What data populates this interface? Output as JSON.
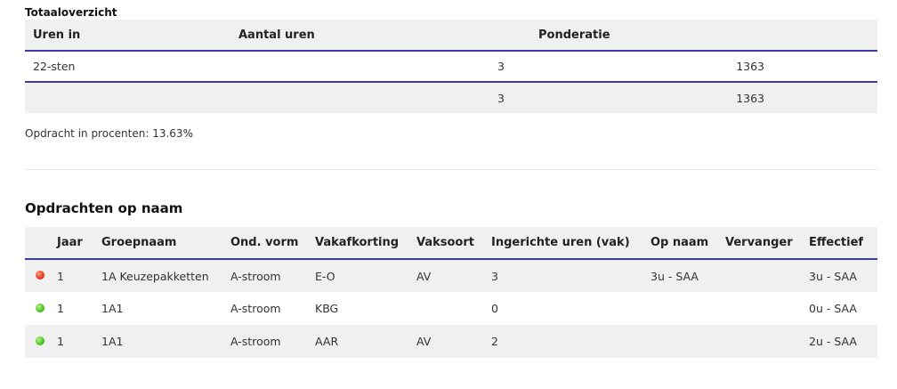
{
  "totaal": {
    "title": "Totaaloverzicht",
    "headers": {
      "uren_in": "Uren in",
      "aantal_uren": "Aantal uren",
      "ponderatie": "Ponderatie"
    },
    "rows": [
      {
        "uren_in": "22-sten",
        "aantal": "3",
        "ponderatie": "1363"
      },
      {
        "uren_in": "",
        "aantal": "3",
        "ponderatie": "1363"
      }
    ],
    "percent_text": "Opdracht in procenten: 13.63%"
  },
  "opdrachten": {
    "title": "Opdrachten op naam",
    "headers": {
      "jaar": "Jaar",
      "groepnaam": "Groepnaam",
      "ond_vorm": "Ond. vorm",
      "vakafkorting": "Vakafkorting",
      "vaksoort": "Vaksoort",
      "ingerichte_uren": "Ingerichte uren (vak)",
      "op_naam": "Op naam",
      "vervanger": "Vervanger",
      "effectief": "Effectief"
    },
    "rows": [
      {
        "status": "red",
        "jaar": "1",
        "groepnaam": "1A Keuzepakketten",
        "ond_vorm": "A-stroom",
        "vakafkorting": "E-O",
        "vaksoort": "AV",
        "ingerichte_uren": "3",
        "op_naam": "3u - SAA",
        "vervanger": "",
        "effectief": "3u - SAA"
      },
      {
        "status": "green",
        "jaar": "1",
        "groepnaam": "1A1",
        "ond_vorm": "A-stroom",
        "vakafkorting": "KBG",
        "vaksoort": "",
        "ingerichte_uren": "0",
        "op_naam": "",
        "vervanger": "",
        "effectief": "0u - SAA"
      },
      {
        "status": "green",
        "jaar": "1",
        "groepnaam": "1A1",
        "ond_vorm": "A-stroom",
        "vakafkorting": "AAR",
        "vaksoort": "AV",
        "ingerichte_uren": "2",
        "op_naam": "",
        "vervanger": "",
        "effectief": "2u - SAA"
      }
    ]
  },
  "colors": {
    "accent_line": "#3c3c9c",
    "row_alt": "#f0f0f0",
    "status_red": "#e13b1f",
    "status_green": "#48c21f"
  }
}
